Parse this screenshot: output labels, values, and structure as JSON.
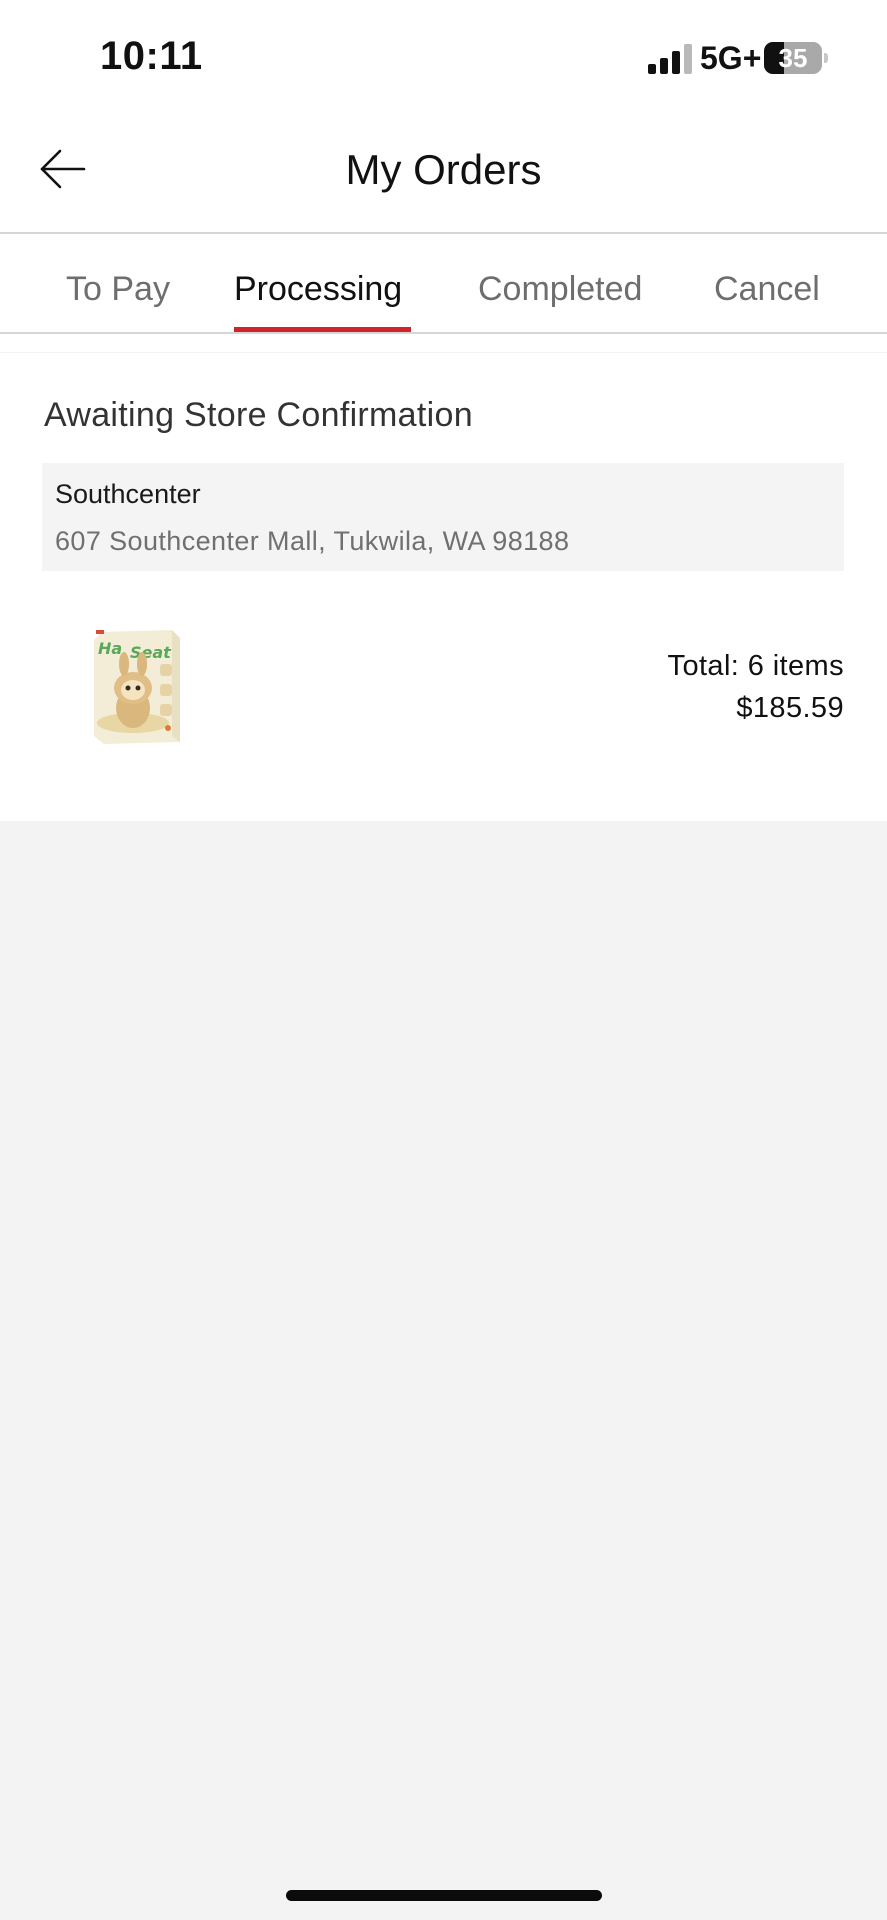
{
  "status_bar": {
    "time": "10:11",
    "network": "5G+",
    "battery_level": "35",
    "icons": [
      "cellular-signal-icon",
      "battery-icon"
    ]
  },
  "header": {
    "title": "My Orders",
    "back_icon": "arrow-left-icon"
  },
  "tabs": [
    {
      "label": "To Pay",
      "active": false
    },
    {
      "label": "Processing",
      "active": true
    },
    {
      "label": "Completed",
      "active": false
    },
    {
      "label": "Cancel",
      "active": false
    }
  ],
  "order": {
    "status": "Awaiting Store Confirmation",
    "store": {
      "name": "Southcenter",
      "address": "607 Southcenter Mall, Tukwila, WA 98188"
    },
    "product_image": "product-box-thumbnail",
    "total_items": "Total: 6 items",
    "total_price": "$185.59"
  },
  "colors": {
    "accent": "#d0232a",
    "background": "#f3f3f3",
    "card": "#ffffff",
    "store_box": "#f4f4f4",
    "inactive_tab": "#6e6e6e"
  }
}
